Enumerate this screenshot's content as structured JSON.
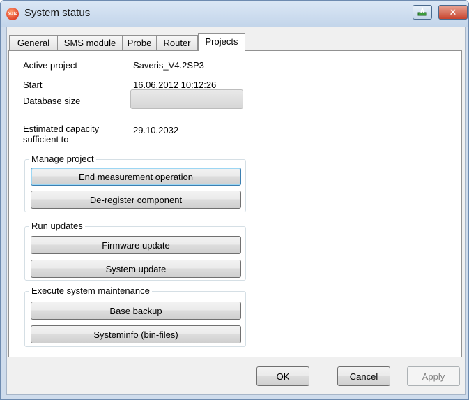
{
  "window": {
    "title": "System status",
    "logo_text": "testo",
    "close_glyph": "✕"
  },
  "icons": {
    "app": "testo-logo-icon",
    "help": "help-icon",
    "close": "close-icon"
  },
  "tabs": [
    {
      "label": "General",
      "active": false
    },
    {
      "label": "SMS module",
      "active": false
    },
    {
      "label": "Probe",
      "active": false
    },
    {
      "label": "Router",
      "active": false
    },
    {
      "label": "Projects",
      "active": true
    }
  ],
  "projects": {
    "active_project_label": "Active project",
    "active_project_value": "Saveris_V4.2SP3",
    "start_label": "Start",
    "start_value": "16.06.2012 10:12:26",
    "database_size_label": "Database size",
    "database_size_fraction": 0,
    "capacity_label_line1": "Estimated capacity",
    "capacity_label_line2": "sufficient to",
    "capacity_value": "29.10.2032"
  },
  "groups": {
    "manage": {
      "title": "Manage project",
      "end_measurement": "End measurement operation",
      "deregister": "De-register component"
    },
    "updates": {
      "title": "Run updates",
      "firmware": "Firmware update",
      "system": "System update"
    },
    "maintenance": {
      "title": "Execute system maintenance",
      "base_backup": "Base backup",
      "systeminfo": "Systeminfo (bin-files)"
    }
  },
  "footer": {
    "ok": "OK",
    "cancel": "Cancel",
    "apply": "Apply"
  },
  "colors": {
    "progress_fill": "#06b025",
    "titlebar_close": "#c8452f"
  }
}
